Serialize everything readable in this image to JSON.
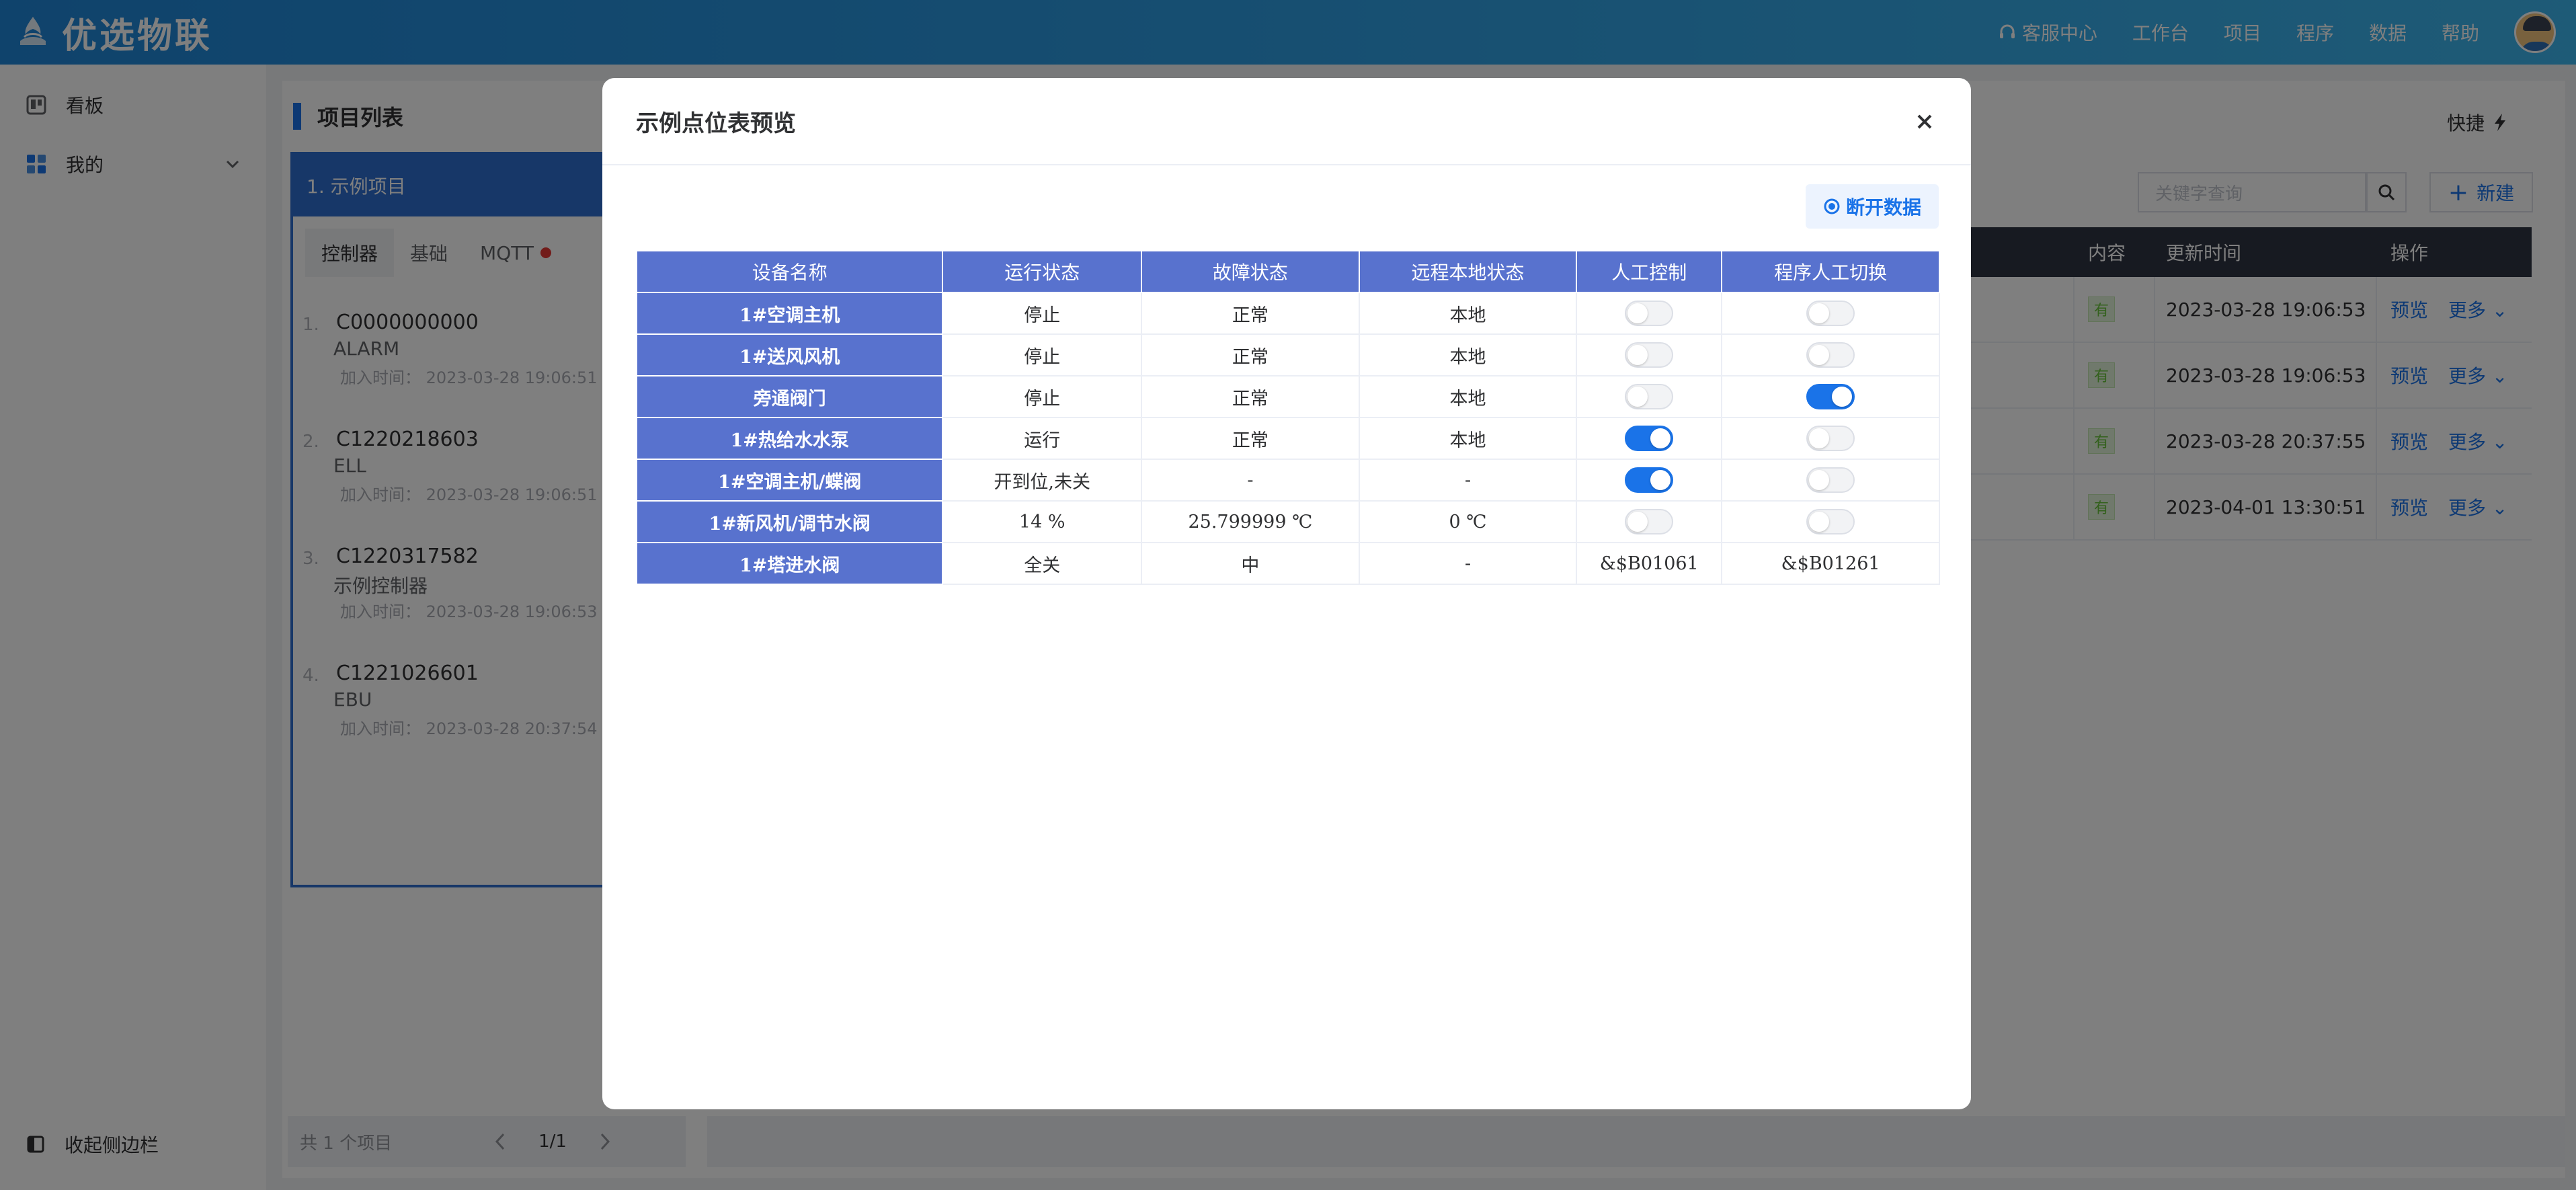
{
  "header": {
    "brand": "优选物联",
    "nav": [
      {
        "label": "客服中心",
        "icon": "headset-icon"
      },
      {
        "label": "工作台"
      },
      {
        "label": "项目"
      },
      {
        "label": "程序"
      },
      {
        "label": "数据"
      },
      {
        "label": "帮助"
      }
    ]
  },
  "sidebar": {
    "items": [
      {
        "label": "看板",
        "icon": "board-icon"
      },
      {
        "label": "我的",
        "icon": "grid-icon"
      }
    ],
    "collapse_label": "收起侧边栏"
  },
  "project_list": {
    "title": "项目列表",
    "quick_label": "快捷",
    "selected_project": "1. 示例项目",
    "tabs": [
      "控制器",
      "基础",
      "MQTT"
    ],
    "controllers": [
      {
        "num": "1.",
        "code": "C0000000000",
        "sub": "ALARM",
        "time": "加入时间： 2023-03-28 19:06:51"
      },
      {
        "num": "2.",
        "code": "C1220218603",
        "sub": "ELL",
        "time": "加入时间： 2023-03-28 19:06:51"
      },
      {
        "num": "3.",
        "code": "C1220317582",
        "sub": "示例控制器",
        "time": "加入时间： 2023-03-28 19:06:53"
      },
      {
        "num": "4.",
        "code": "C1221026601",
        "sub": "EBU",
        "time": "加入时间： 2023-03-28 20:37:54"
      }
    ],
    "pager": {
      "total": "共 1 个项目",
      "page": "1/1"
    }
  },
  "right_table": {
    "search_placeholder": "关键字查询",
    "new_label": "新建",
    "headers": [
      "内容",
      "更新时间",
      "操作"
    ],
    "rows": [
      {
        "tag": "有",
        "time": "2023-03-28 19:06:53",
        "preview": "预览",
        "more": "更多"
      },
      {
        "tag": "有",
        "time": "2023-03-28 19:06:53",
        "preview": "预览",
        "more": "更多"
      },
      {
        "tag": "有",
        "time": "2023-03-28 20:37:55",
        "preview": "预览",
        "more": "更多"
      },
      {
        "tag": "有",
        "time": "2023-04-01 13:30:51",
        "preview": "预览",
        "more": "更多"
      }
    ]
  },
  "dialog": {
    "title": "示例点位表预览",
    "disconnect_label": "断开数据",
    "headers": [
      "设备名称",
      "运行状态",
      "故障状态",
      "远程本地状态",
      "人工控制",
      "程序人工切换"
    ],
    "rows": [
      {
        "name": "1#空调主机",
        "run": "停止",
        "fault": "正常",
        "remote": "本地",
        "manual": false,
        "switch": false
      },
      {
        "name": "1#送风风机",
        "run": "停止",
        "fault": "正常",
        "remote": "本地",
        "manual": false,
        "switch": false
      },
      {
        "name": "旁通阀门",
        "run": "停止",
        "fault": "正常",
        "remote": "本地",
        "manual": false,
        "switch": true
      },
      {
        "name": "1#热给水水泵",
        "run": "运行",
        "fault": "正常",
        "remote": "本地",
        "manual": true,
        "switch": false
      },
      {
        "name": "1#空调主机/蝶阀",
        "run": "开到位,未关",
        "fault": "-",
        "remote": "-",
        "manual": true,
        "switch": false
      },
      {
        "name": "1#新风机/调节水阀",
        "run": "14 %",
        "fault": "25.799999 ℃",
        "remote": "0 ℃",
        "manual": false,
        "switch": false
      },
      {
        "name": "1#塔进水阀",
        "run": "全关",
        "fault": "中",
        "remote": "-",
        "manual_text": "&$B01061",
        "switch_text": "&$B01261"
      }
    ]
  }
}
